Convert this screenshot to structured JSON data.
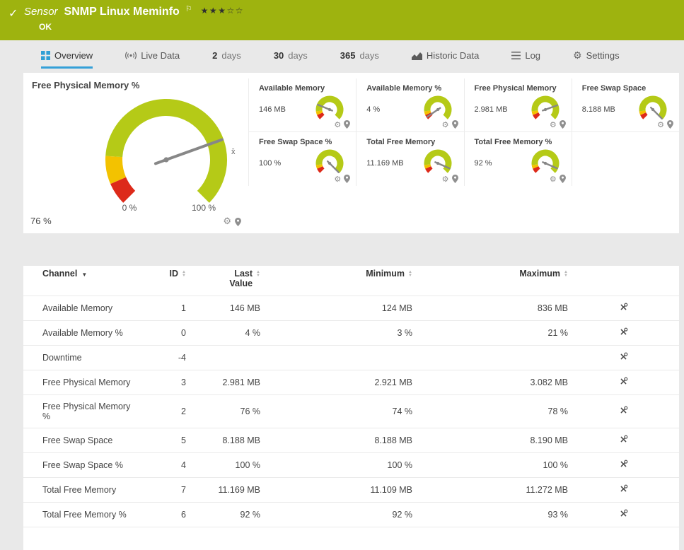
{
  "colors": {
    "header_green": "#9eb30f",
    "accent_blue": "#35a0d8",
    "gauge_green": "#b5ca17",
    "gauge_yellow": "#f3c200",
    "gauge_red": "#dd2a1a",
    "needle_gray": "#878787"
  },
  "icons": {
    "check": "✓",
    "flag": "⚐",
    "star_filled": "★",
    "star_empty": "☆",
    "gear": "⚙",
    "caret_down": "▼",
    "sort_asc": "▲",
    "sort_desc": "▼"
  },
  "header": {
    "kind": "Sensor",
    "title": "SNMP Linux Meminfo",
    "status": "OK",
    "rating": {
      "filled": 3,
      "total": 5
    }
  },
  "tabs": [
    {
      "id": "overview",
      "label": "Overview",
      "icon": "overview-icon",
      "active": true
    },
    {
      "id": "live-data",
      "label": "Live Data",
      "icon": "live-data-icon",
      "active": false
    },
    {
      "id": "2-days",
      "number": "2",
      "label": "days",
      "active": false
    },
    {
      "id": "30-days",
      "number": "30",
      "label": "days",
      "active": false
    },
    {
      "id": "365-days",
      "number": "365",
      "label": "days",
      "active": false
    },
    {
      "id": "historic-data",
      "label": "Historic Data",
      "icon": "historic-data-icon",
      "active": false
    },
    {
      "id": "log",
      "label": "Log",
      "icon": "log-icon",
      "active": false
    },
    {
      "id": "settings",
      "label": "Settings",
      "icon": "settings-icon",
      "active": false
    }
  ],
  "gauges": {
    "needle_color": "#878787",
    "primary": {
      "title": "Free Physical Memory %",
      "value_label": "76 %",
      "percent": 76,
      "min_label": "0 %",
      "max_label": "100 %",
      "average_marker": "x̄",
      "segments": [
        {
          "from": 0,
          "to": 8,
          "color": "#dd2a1a"
        },
        {
          "from": 8,
          "to": 18,
          "color": "#f3c200"
        },
        {
          "from": 18,
          "to": 100,
          "color": "#b5ca17"
        }
      ]
    },
    "mini_segments": [
      {
        "from": 0,
        "to": 8,
        "color": "#dd2a1a"
      },
      {
        "from": 8,
        "to": 14,
        "color": "#f3c200"
      },
      {
        "from": 14,
        "to": 100,
        "color": "#b5ca17"
      }
    ],
    "minis": [
      {
        "title": "Available Memory",
        "value_label": "146 MB",
        "percent": 25
      },
      {
        "title": "Available Memory %",
        "value_label": "4 %",
        "percent": 4
      },
      {
        "title": "Free Physical Memory",
        "value_label": "2.981 MB",
        "percent": 76
      },
      {
        "title": "Free Swap Space",
        "value_label": "8.188 MB",
        "percent": 100
      },
      {
        "title": "Free Swap Space %",
        "value_label": "100 %",
        "percent": 100
      },
      {
        "title": "Total Free Memory",
        "value_label": "11.169 MB",
        "percent": 92
      },
      {
        "title": "Total Free Memory %",
        "value_label": "92 %",
        "percent": 92
      }
    ]
  },
  "table": {
    "columns": [
      {
        "key": "channel",
        "label": "Channel",
        "sortable": true
      },
      {
        "key": "id",
        "label": "ID",
        "sortable": true
      },
      {
        "key": "last_value",
        "label": "Last Value",
        "sortable": true
      },
      {
        "key": "minimum",
        "label": "Minimum",
        "sortable": true
      },
      {
        "key": "maximum",
        "label": "Maximum",
        "sortable": true
      }
    ],
    "rows": [
      {
        "channel": "Available Memory",
        "id": "1",
        "last_value": "146 MB",
        "minimum": "124 MB",
        "maximum": "836 MB"
      },
      {
        "channel": "Available Memory %",
        "id": "0",
        "last_value": "4 %",
        "minimum": "3 %",
        "maximum": "21 %"
      },
      {
        "channel": "Downtime",
        "id": "-4",
        "last_value": "",
        "minimum": "",
        "maximum": ""
      },
      {
        "channel": "Free Physical Memory",
        "id": "3",
        "last_value": "2.981 MB",
        "minimum": "2.921 MB",
        "maximum": "3.082 MB"
      },
      {
        "channel": "Free Physical Memory %",
        "id": "2",
        "last_value": "76 %",
        "minimum": "74 %",
        "maximum": "78 %"
      },
      {
        "channel": "Free Swap Space",
        "id": "5",
        "last_value": "8.188 MB",
        "minimum": "8.188 MB",
        "maximum": "8.190 MB"
      },
      {
        "channel": "Free Swap Space %",
        "id": "4",
        "last_value": "100 %",
        "minimum": "100 %",
        "maximum": "100 %"
      },
      {
        "channel": "Total Free Memory",
        "id": "7",
        "last_value": "11.169 MB",
        "minimum": "11.109 MB",
        "maximum": "11.272 MB"
      },
      {
        "channel": "Total Free Memory %",
        "id": "6",
        "last_value": "92 %",
        "minimum": "92 %",
        "maximum": "93 %"
      }
    ]
  }
}
